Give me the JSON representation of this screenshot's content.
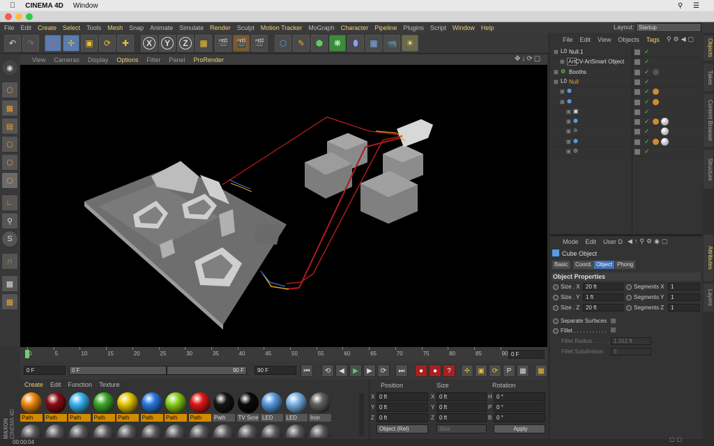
{
  "mac": {
    "apple": "",
    "app": "CINEMA 4D",
    "menu": "Window"
  },
  "menubar": [
    {
      "label": "File",
      "hl": false
    },
    {
      "label": "Edit",
      "hl": false
    },
    {
      "label": "Create",
      "hl": true
    },
    {
      "label": "Select",
      "hl": true
    },
    {
      "label": "Tools",
      "hl": false
    },
    {
      "label": "Mesh",
      "hl": true
    },
    {
      "label": "Snap",
      "hl": false
    },
    {
      "label": "Animate",
      "hl": false
    },
    {
      "label": "Simulate",
      "hl": false
    },
    {
      "label": "Render",
      "hl": true
    },
    {
      "label": "Sculpt",
      "hl": false
    },
    {
      "label": "Motion Tracker",
      "hl": true
    },
    {
      "label": "MoGraph",
      "hl": false
    },
    {
      "label": "Character",
      "hl": true
    },
    {
      "label": "Pipeline",
      "hl": true
    },
    {
      "label": "Plugins",
      "hl": false
    },
    {
      "label": "Script",
      "hl": false
    },
    {
      "label": "Window",
      "hl": true
    },
    {
      "label": "Help",
      "hl": true
    }
  ],
  "layout": {
    "label": "Layout:",
    "value": "Startup"
  },
  "toolbar": {
    "x": "X",
    "y": "Y",
    "z": "Z"
  },
  "viewport_menu": [
    {
      "label": "View",
      "hl": false
    },
    {
      "label": "Cameras",
      "hl": false
    },
    {
      "label": "Display",
      "hl": false
    },
    {
      "label": "Options",
      "hl": true
    },
    {
      "label": "Filter",
      "hl": false
    },
    {
      "label": "Panel",
      "hl": false
    },
    {
      "label": "ProRender",
      "hl": true
    }
  ],
  "timeline": {
    "ticks": [
      "0",
      "5",
      "10",
      "15",
      "20",
      "25",
      "30",
      "35",
      "40",
      "45",
      "50",
      "55",
      "60",
      "65",
      "70",
      "75",
      "80",
      "85",
      "90"
    ],
    "current": "0 F"
  },
  "controls": {
    "start": "0 F",
    "range_start": "0 F",
    "range_end": "90 F",
    "end": "90 F"
  },
  "matmenu": [
    "Create",
    "Edit",
    "Function",
    "Texture"
  ],
  "materials_row1": [
    {
      "label": "Path",
      "color": "#f08a10",
      "sel": true
    },
    {
      "label": "Path",
      "color": "#8a0c14",
      "sel": true
    },
    {
      "label": "Path",
      "color": "#3ab4f0",
      "sel": true
    },
    {
      "label": "Path",
      "color": "#3caa2a",
      "sel": true
    },
    {
      "label": "Path",
      "color": "#e8c800",
      "sel": true
    },
    {
      "label": "Path",
      "color": "#2a7ae0",
      "sel": true
    },
    {
      "label": "Path",
      "color": "#8ad01a",
      "sel": true
    },
    {
      "label": "Path",
      "color": "#e01818",
      "sel": true
    },
    {
      "label": "Path",
      "color": "#151515",
      "sel": false
    },
    {
      "label": "TV Scre",
      "color": "#0a0a0a",
      "sel": false
    },
    {
      "label": "LED",
      "color": "#5a9ae0",
      "sel": false
    },
    {
      "label": "LED",
      "color": "#7ab4e8",
      "sel": false
    },
    {
      "label": "Iron",
      "color": "#606060",
      "sel": false
    }
  ],
  "maxon": {
    "line1": "MAXON",
    "line2": "CINEMA 4D"
  },
  "coord": {
    "headers": [
      "Position",
      "Size",
      "Rotation"
    ],
    "rows": [
      {
        "a": "X",
        "pos": "0 ft",
        "b": "X",
        "size": "0 ft",
        "c": "H",
        "rot": "0 °"
      },
      {
        "a": "Y",
        "pos": "0 ft",
        "b": "Y",
        "size": "0 ft",
        "c": "P",
        "rot": "0 °"
      },
      {
        "a": "Z",
        "pos": "0 ft",
        "b": "Z",
        "size": "0 ft",
        "c": "B",
        "rot": "0 °"
      }
    ],
    "mode": "Object (Rel)",
    "size_mode": "Size",
    "apply": "Apply"
  },
  "status": "00:00:04",
  "objmenu": [
    "File",
    "Edit",
    "View",
    "Objects",
    "Tags"
  ],
  "objects": [
    {
      "name": "Null.1",
      "indent": 0,
      "icon": "L0",
      "color": "#ddd"
    },
    {
      "name": "CV-ArtSmart Object",
      "indent": 1,
      "icon": "Art",
      "color": "#ddd"
    },
    {
      "name": "Booths",
      "indent": 0,
      "icon": "gear",
      "color": "#ddd"
    },
    {
      "name": "Null",
      "indent": 0,
      "icon": "L0",
      "color": "#f0a030"
    },
    {
      "name": "",
      "indent": 1,
      "icon": "cube",
      "color": "#ddd"
    },
    {
      "name": "",
      "indent": 1,
      "icon": "cube",
      "color": "#ddd"
    },
    {
      "name": "",
      "indent": 2,
      "icon": "cam",
      "color": "#ddd"
    },
    {
      "name": "",
      "indent": 2,
      "icon": "cube",
      "color": "#ddd"
    },
    {
      "name": "",
      "indent": 2,
      "icon": "light",
      "color": "#ddd"
    },
    {
      "name": "",
      "indent": 2,
      "icon": "cube",
      "color": "#ddd"
    },
    {
      "name": "",
      "indent": 2,
      "icon": "gear",
      "color": "#ddd"
    }
  ],
  "attrmenu": [
    "Mode",
    "Edit",
    "User D"
  ],
  "attr": {
    "title": "Cube Object",
    "tabs": [
      "Basic",
      "Coord.",
      "Object",
      "Phong"
    ],
    "section": "Object Properties",
    "props": [
      {
        "label": "Size . X",
        "value": "20 ft",
        "seg_label": "Segments X",
        "seg": "1"
      },
      {
        "label": "Size . Y",
        "value": "1 ft",
        "seg_label": "Segments Y",
        "seg": "1"
      },
      {
        "label": "Size . Z",
        "value": "20 ft",
        "seg_label": "Segments Z",
        "seg": "1"
      }
    ],
    "separate": "Separate Surfaces",
    "fillet": "Fillet . . . . . . . . . . .",
    "fillet_radius_label": "Fillet Radius. . . . . .",
    "fillet_radius": "1.312 ft",
    "fillet_sub_label": "Fillet Subdivision",
    "fillet_sub": "5"
  },
  "sidetabs": [
    "Objects",
    "Takes",
    "Content Browser",
    "Structure",
    "Attributes",
    "Layers"
  ]
}
